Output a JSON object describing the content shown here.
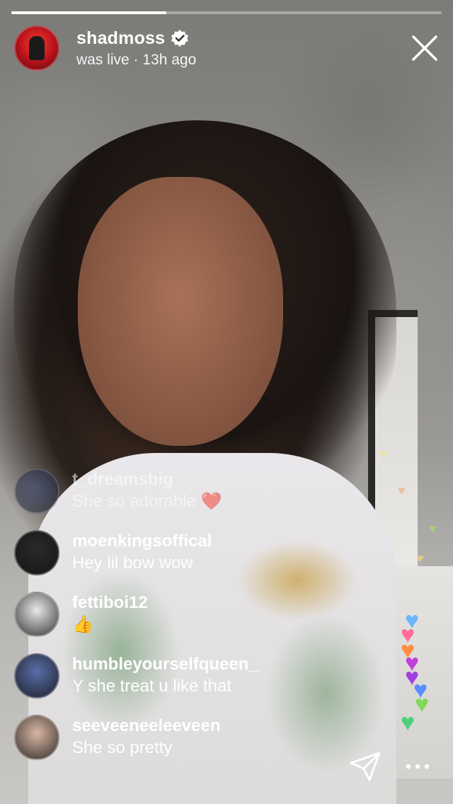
{
  "progress": {
    "played_fraction": 0.36
  },
  "header": {
    "username": "shadmoss",
    "verified": true,
    "status": "was live · 13h ago"
  },
  "comments": [
    {
      "user": "t_dreamsbig",
      "message": "She so adorable ❤️",
      "avatar_color": "#3b4a7a"
    },
    {
      "user": "moenkingsoffical",
      "message": "Hey lil bow wow",
      "avatar_color": "#2a2a2a"
    },
    {
      "user": "fettiboi12",
      "message": "👍",
      "avatar_color": "#e8e8e8"
    },
    {
      "user": "humbleyourselfqueen_",
      "message": "Y she treat u like that",
      "avatar_color": "#5a6ea8"
    },
    {
      "user": "seeveeneeleeveen",
      "message": "She so pretty",
      "avatar_color": "#d9b7a4"
    }
  ],
  "reactions": {
    "heart_colors": [
      "#6ab7ff",
      "#ff6b9a",
      "#ff8c42",
      "#c03fd8",
      "#a23fe0",
      "#5a8cff",
      "#7ed957",
      "#4fcf7a"
    ]
  },
  "icons": [
    "verified-badge-icon",
    "close-icon",
    "send-icon",
    "more-icon"
  ]
}
